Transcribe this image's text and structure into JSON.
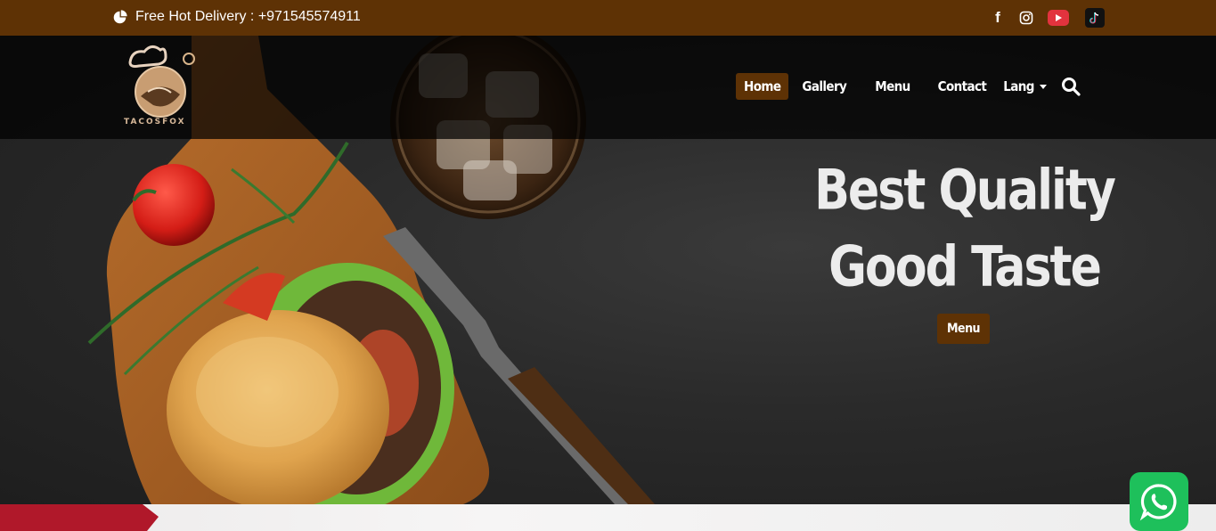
{
  "topbar": {
    "delivery_text": "Free Hot Delivery : +971545574911",
    "icon": "pie-chart-icon",
    "socials": [
      "facebook-icon",
      "instagram-icon",
      "youtube-icon",
      "tiktok-icon"
    ]
  },
  "brand": {
    "logo_text": "TACOSFOX"
  },
  "nav": {
    "home": "Home",
    "gallery": "Gallery",
    "menu": "Menu",
    "contact": "Contact",
    "lang": "Lang"
  },
  "hero": {
    "line1": "Best Quality",
    "line2": "Good Taste",
    "cta": "Menu"
  },
  "colors": {
    "brand_brown": "#5e3205",
    "accent_red": "#b0182a",
    "whatsapp_green": "#1ec05b"
  }
}
